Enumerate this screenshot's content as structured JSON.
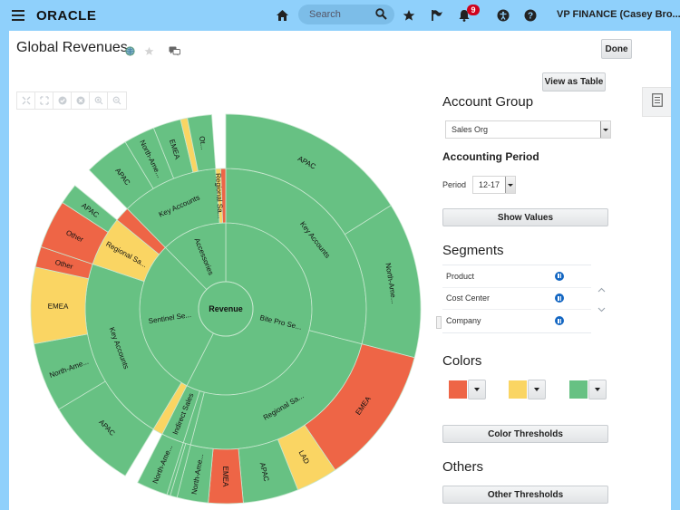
{
  "header": {
    "logo": "ORACLE",
    "search_placeholder": "Search",
    "notifications_count": "9",
    "user_label": "VP FINANCE (Casey Bro..."
  },
  "page": {
    "title": "Global Revenues",
    "done_label": "Done",
    "view_as_table_label": "View as Table"
  },
  "settings": {
    "account_group_heading": "Account Group",
    "account_group_value": "Sales Org",
    "accounting_period_heading": "Accounting Period",
    "period_label": "Period",
    "period_value": "12-17",
    "show_values_label": "Show Values",
    "segments_heading": "Segments",
    "segments": [
      {
        "label": "Product"
      },
      {
        "label": "Cost Center"
      },
      {
        "label": "Company"
      }
    ],
    "colors_heading": "Colors",
    "colors": [
      {
        "name": "red",
        "hex": "#ee6546"
      },
      {
        "name": "yellow",
        "hex": "#fad563"
      },
      {
        "name": "green",
        "hex": "#67c183"
      }
    ],
    "color_thresholds_label": "Color Thresholds",
    "others_heading": "Others",
    "other_thresholds_label": "Other Thresholds"
  },
  "chart_data": {
    "type": "sunburst",
    "root": "Revenue",
    "palette": {
      "green": "#67c183",
      "yellow": "#fad563",
      "red": "#ee6546"
    },
    "children": [
      {
        "label": "Bite Pro Se...",
        "color": "green",
        "children": [
          {
            "label": "Key Accounts",
            "color": "green",
            "children": [
              {
                "label": "APAC",
                "value": 56,
                "color": "green"
              },
              {
                "label": "North-Ame...",
                "value": 45,
                "color": "green"
              }
            ]
          },
          {
            "label": "Regional Sa...",
            "color": "green",
            "children": [
              {
                "label": "EMEA",
                "value": 40,
                "color": "red"
              },
              {
                "label": "LAD",
                "value": 12,
                "color": "yellow"
              },
              {
                "label": "APAC",
                "value": 16,
                "color": "green"
              },
              {
                "label": "EMEA",
                "value": 10,
                "color": "red"
              },
              {
                "label": "North-Ame...",
                "value": 9,
                "color": "green"
              }
            ]
          },
          {
            "label": "",
            "color": "green",
            "children": [
              {
                "label": "",
                "value": 2,
                "color": "green"
              },
              {
                "label": "",
                "value": 1,
                "color": "green"
              }
            ]
          },
          {
            "label": "Indirect Sales",
            "color": "green",
            "children": [
              {
                "label": "North-Ame...",
                "value": 9,
                "color": "green"
              }
            ]
          }
        ]
      },
      {
        "label": "Sentinel Se...",
        "color": "green",
        "children": [
          {
            "label": "",
            "color": "yellow",
            "children": [
              {
                "label": "",
                "value": 4,
                "color": "gap"
              }
            ]
          },
          {
            "label": "Key Accounts",
            "color": "green",
            "children": [
              {
                "label": "APAC",
                "value": 27,
                "color": "green"
              },
              {
                "label": "North-Ame...",
                "value": 20,
                "color": "green"
              },
              {
                "label": "EMEA",
                "value": 22,
                "color": "yellow"
              },
              {
                "label": "Other",
                "value": 6,
                "color": "red"
              }
            ]
          },
          {
            "label": "Regional Sa...",
            "color": "yellow",
            "children": [
              {
                "label": "Other",
                "value": 14,
                "color": "red"
              },
              {
                "label": "APAC",
                "value": 6,
                "color": "green"
              }
            ]
          },
          {
            "label": "",
            "color": "red",
            "children": [
              {
                "label": "",
                "value": 6,
                "color": "gap"
              }
            ]
          }
        ]
      },
      {
        "label": "Accessories",
        "color": "green",
        "children": [
          {
            "label": "Key Accounts",
            "color": "green",
            "children": [
              {
                "label": "APAC",
                "value": 13,
                "color": "green"
              },
              {
                "label": "North-Ame...",
                "value": 9,
                "color": "green"
              },
              {
                "label": "EMEA",
                "value": 8,
                "color": "green"
              },
              {
                "label": "",
                "value": 2,
                "color": "yellow"
              },
              {
                "label": "Ot...",
                "value": 7,
                "color": "green"
              }
            ]
          },
          {
            "label": "Regional Sa...",
            "color": "yellow",
            "children": [
              {
                "label": "",
                "value": 2,
                "color": "gap"
              }
            ]
          },
          {
            "label": "",
            "color": "red",
            "children": [
              {
                "label": "",
                "value": 2,
                "color": "gap"
              }
            ]
          }
        ]
      }
    ]
  }
}
